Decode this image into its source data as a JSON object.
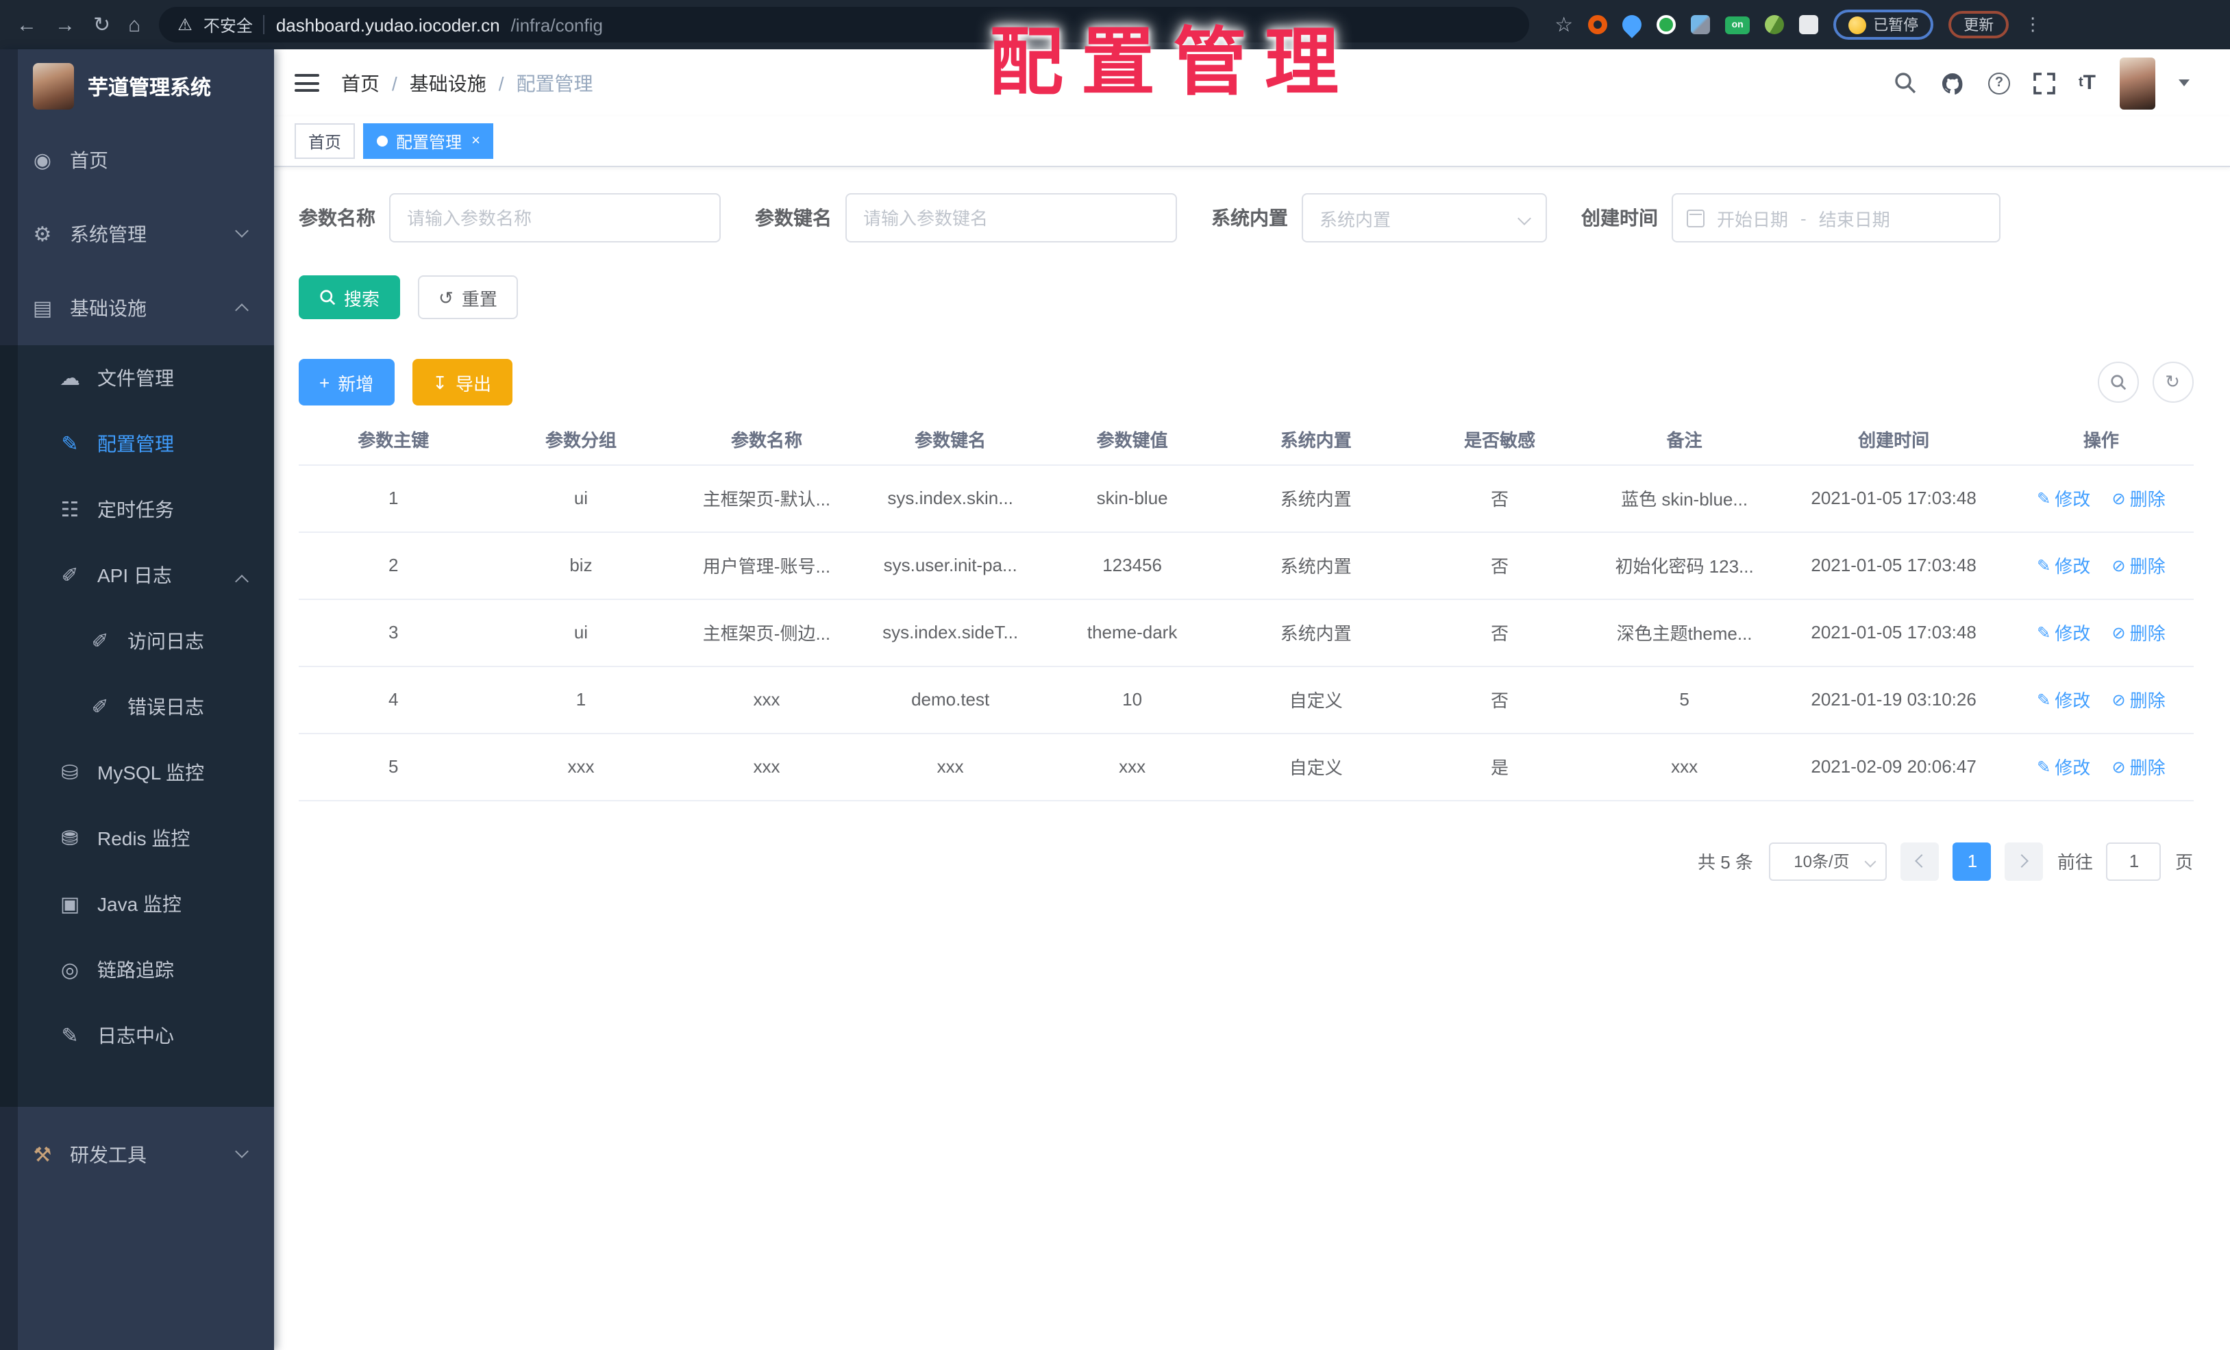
{
  "watermark": {
    "text": "配置管理",
    "color": "#ee2b52"
  },
  "browser": {
    "security_label": "不安全",
    "url_host": "dashboard.yudao.iocoder.cn",
    "url_path": "/infra/config",
    "extension_badge": "on",
    "paused_button": "已暂停",
    "update_button": "更新"
  },
  "sidebar": {
    "title": "芋道管理系统",
    "menu": [
      {
        "label": "首页",
        "icon": "dashboard-icon",
        "level": 1
      },
      {
        "label": "系统管理",
        "icon": "gear-icon",
        "level": 1,
        "chevron": "down"
      },
      {
        "label": "基础设施",
        "icon": "monitor-icon",
        "level": 1,
        "chevron": "up"
      },
      {
        "label": "文件管理",
        "icon": "cloud-icon",
        "level": 2
      },
      {
        "label": "配置管理",
        "icon": "edit-square-icon",
        "level": 2,
        "active": true
      },
      {
        "label": "定时任务",
        "icon": "clock-icon",
        "level": 2
      },
      {
        "label": "API 日志",
        "icon": "log-icon",
        "level": 2,
        "chevron": "up"
      },
      {
        "label": "访问日志",
        "icon": "access-log-icon",
        "level": 3
      },
      {
        "label": "错误日志",
        "icon": "error-log-icon",
        "level": 3
      },
      {
        "label": "MySQL 监控",
        "icon": "mysql-db-icon",
        "level": 2
      },
      {
        "label": "Redis 监控",
        "icon": "redis-db-icon",
        "level": 2
      },
      {
        "label": "Java 监控",
        "icon": "java-monitor-icon",
        "level": 2
      },
      {
        "label": "链路追踪",
        "icon": "eye-icon",
        "level": 2
      },
      {
        "label": "日志中心",
        "icon": "log-center-icon",
        "level": 2
      },
      {
        "label": "研发工具",
        "icon": "briefcase-icon",
        "level": 1,
        "chevron": "down"
      }
    ]
  },
  "topbar": {
    "breadcrumb": [
      "首页",
      "基础设施",
      "配置管理"
    ],
    "separator": "/"
  },
  "tabs": [
    {
      "label": "首页",
      "active": false
    },
    {
      "label": "配置管理",
      "active": true
    }
  ],
  "filters": {
    "name_label": "参数名称",
    "name_placeholder": "请输入参数名称",
    "key_label": "参数键名",
    "key_placeholder": "请输入参数键名",
    "type_label": "系统内置",
    "type_placeholder": "系统内置",
    "date_label": "创建时间",
    "date_start_placeholder": "开始日期",
    "date_separator": "-",
    "date_end_placeholder": "结束日期"
  },
  "toolbar": {
    "search": "搜索",
    "reset": "重置",
    "add": "新增",
    "export": "导出"
  },
  "table": {
    "columns": [
      "参数主键",
      "参数分组",
      "参数名称",
      "参数键名",
      "参数键值",
      "系统内置",
      "是否敏感",
      "备注",
      "创建时间",
      "操作"
    ],
    "edit_label": "修改",
    "delete_label": "删除",
    "rows": [
      {
        "cells": [
          "1",
          "ui",
          "主框架页-默认...",
          "sys.index.skin...",
          "skin-blue",
          "系统内置",
          "否",
          "蓝色 skin-blue...",
          "2021-01-05 17:03:48"
        ]
      },
      {
        "cells": [
          "2",
          "biz",
          "用户管理-账号...",
          "sys.user.init-pa...",
          "123456",
          "系统内置",
          "否",
          "初始化密码 123...",
          "2021-01-05 17:03:48"
        ]
      },
      {
        "cells": [
          "3",
          "ui",
          "主框架页-侧边...",
          "sys.index.sideT...",
          "theme-dark",
          "系统内置",
          "否",
          "深色主题theme...",
          "2021-01-05 17:03:48"
        ]
      },
      {
        "cells": [
          "4",
          "1",
          "xxx",
          "demo.test",
          "10",
          "自定义",
          "否",
          "5",
          "2021-01-19 03:10:26"
        ]
      },
      {
        "cells": [
          "5",
          "xxx",
          "xxx",
          "xxx",
          "xxx",
          "自定义",
          "是",
          "xxx",
          "2021-02-09 20:06:47"
        ]
      }
    ]
  },
  "pagination": {
    "total": "共 5 条",
    "page_size": "10条/页",
    "current_page": "1",
    "goto_label": "前往",
    "goto_value": "1",
    "page_unit": "页"
  },
  "colors": {
    "accent_blue": "#409eff",
    "search_teal": "#17b794",
    "export_orange": "#f4ab0c",
    "sidebar_bg": "#2e3a50",
    "submenu_bg": "#1d2a38",
    "watermark_red": "#ee2b52"
  }
}
